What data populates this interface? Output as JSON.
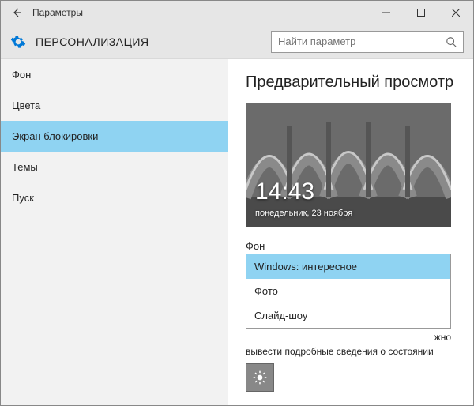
{
  "titlebar": {
    "title": "Параметры"
  },
  "header": {
    "title": "ПЕРСОНАЛИЗАЦИЯ",
    "search_placeholder": "Найти параметр"
  },
  "sidebar": {
    "items": [
      {
        "label": "Фон"
      },
      {
        "label": "Цвета"
      },
      {
        "label": "Экран блокировки"
      },
      {
        "label": "Темы"
      },
      {
        "label": "Пуск"
      }
    ]
  },
  "content": {
    "preview_title": "Предварительный просмотр",
    "preview_time": "14:43",
    "preview_date": "понедельник, 23 ноября",
    "background_label": "Фон",
    "dropdown": {
      "options": [
        {
          "label": "Windows: интересное"
        },
        {
          "label": "Фото"
        },
        {
          "label": "Слайд-шоу"
        }
      ]
    },
    "hint_line1": "жно",
    "hint_line2": "вывести подробные сведения о состоянии"
  }
}
